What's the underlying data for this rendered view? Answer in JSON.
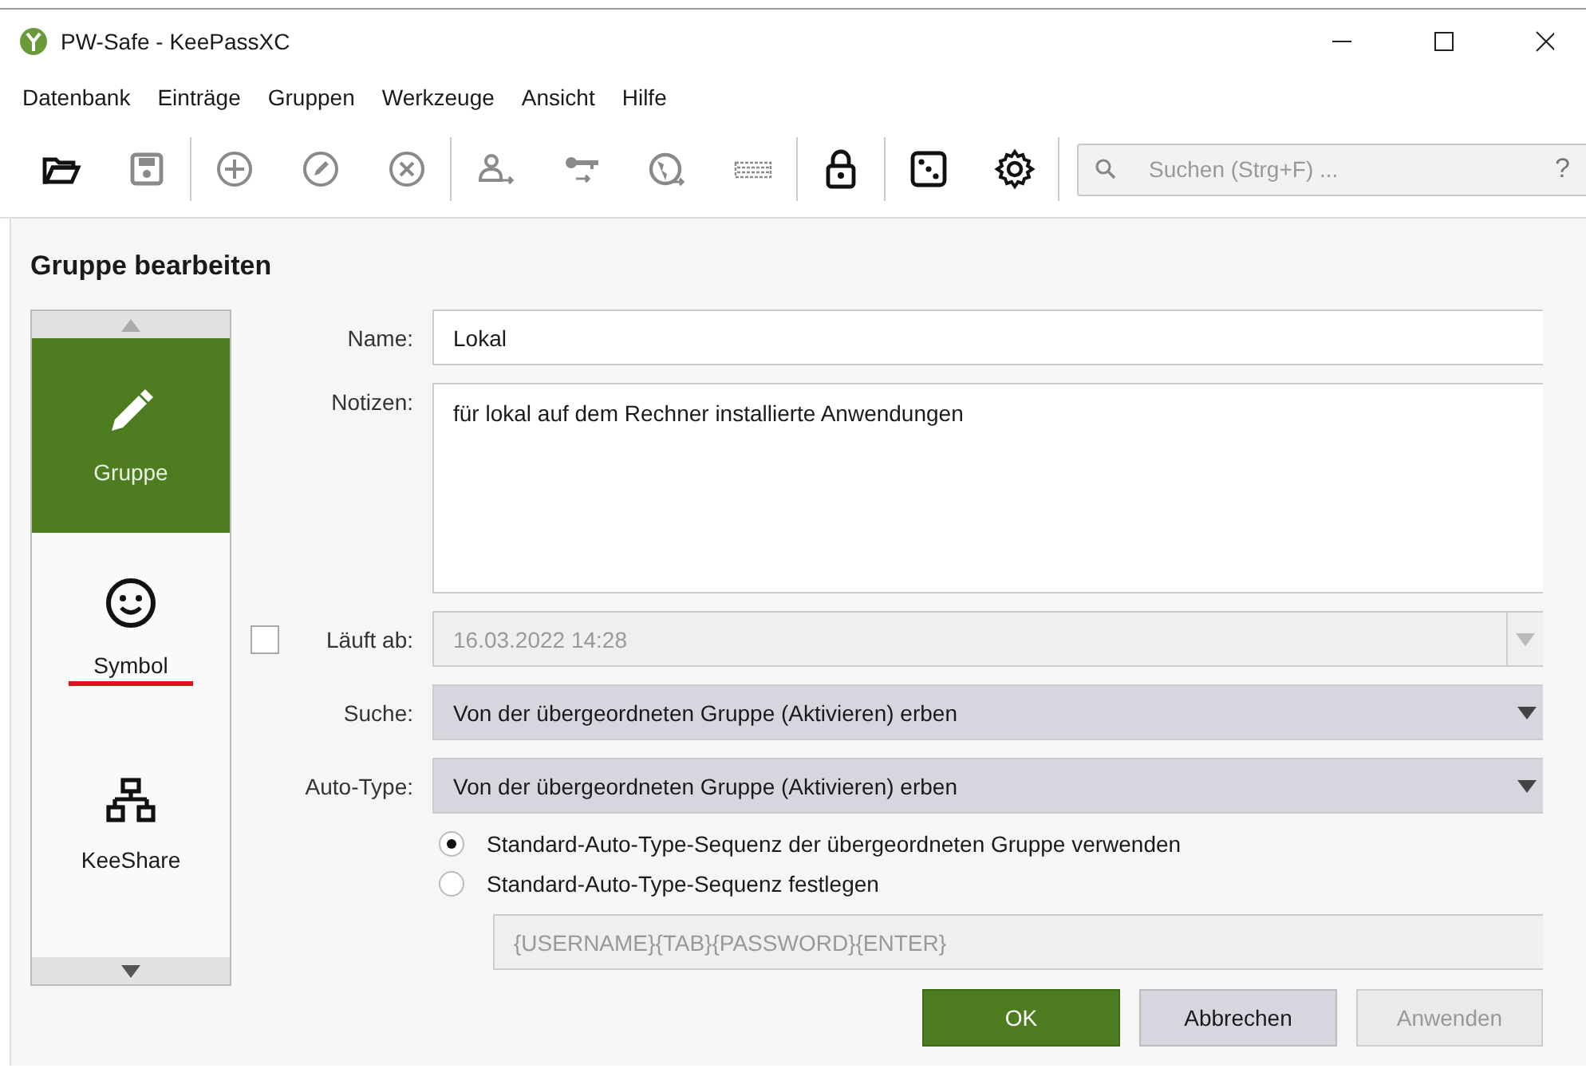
{
  "window": {
    "title": "PW-Safe - KeePassXC"
  },
  "menu": [
    "Datenbank",
    "Einträge",
    "Gruppen",
    "Werkzeuge",
    "Ansicht",
    "Hilfe"
  ],
  "toolbar": [
    [
      {
        "kind": "open",
        "disabled": false
      },
      {
        "kind": "save",
        "disabled": true
      }
    ],
    [
      {
        "kind": "add",
        "disabled": true
      },
      {
        "kind": "edit",
        "disabled": true
      },
      {
        "kind": "delete",
        "disabled": true
      }
    ],
    [
      {
        "kind": "user",
        "disabled": true
      },
      {
        "kind": "key",
        "disabled": true
      },
      {
        "kind": "globe",
        "disabled": true
      },
      {
        "kind": "keyboard",
        "disabled": true
      }
    ],
    [
      {
        "kind": "lock",
        "disabled": false
      }
    ],
    [
      {
        "kind": "dice",
        "disabled": false
      },
      {
        "kind": "gear",
        "disabled": false
      }
    ]
  ],
  "search": {
    "placeholder": "Suchen (Strg+F) ...",
    "help": "?"
  },
  "dialog_title": "Gruppe bearbeiten",
  "sidebar": {
    "items": [
      {
        "label": "Gruppe",
        "kind": "edit",
        "selected": true,
        "marked": false
      },
      {
        "label": "Symbol",
        "kind": "smiley",
        "selected": false,
        "marked": true
      },
      {
        "label": "KeeShare",
        "kind": "network",
        "selected": false,
        "marked": false
      }
    ]
  },
  "form": {
    "name": {
      "label": "Name:",
      "value": "Lokal"
    },
    "notes": {
      "label": "Notizen:",
      "value": "für lokal auf dem Rechner installierte Anwendungen"
    },
    "expires": {
      "label": "Läuft ab:",
      "checked": false,
      "value": "16.03.2022 14:28"
    },
    "search": {
      "label": "Suche:",
      "value": "Von der übergeordneten Gruppe (Aktivieren) erben"
    },
    "autotype": {
      "label": "Auto-Type:",
      "value": "Von der übergeordneten Gruppe (Aktivieren) erben"
    },
    "options": [
      {
        "label": "Standard-Auto-Type-Sequenz der übergeordneten Gruppe verwenden",
        "selected": true
      },
      {
        "label": "Standard-Auto-Type-Sequenz festlegen",
        "selected": false
      }
    ],
    "sequence": {
      "value": "{USERNAME}{TAB}{PASSWORD}{ENTER}"
    }
  },
  "buttons": [
    {
      "label": "OK",
      "kind": "primary",
      "disabled": false
    },
    {
      "label": "Abbrechen",
      "kind": "normal",
      "disabled": false
    },
    {
      "label": "Anwenden",
      "kind": "normal",
      "disabled": true
    }
  ]
}
